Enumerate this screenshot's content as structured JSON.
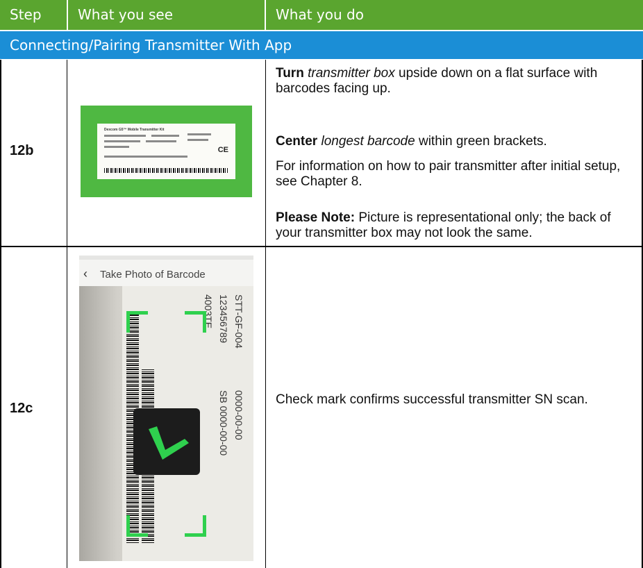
{
  "header": {
    "step_label": "Step",
    "see_label": "What you see",
    "do_label": "What you do"
  },
  "section": {
    "title": "Connecting/Pairing Transmitter With App"
  },
  "rows": [
    {
      "step": "12b",
      "image": {
        "kind": "transmitter-box-label",
        "card_title": "Dexcom G5™ Mobile Transmitter Kit",
        "mark": "CE"
      },
      "instructions": [
        {
          "bold": "Turn",
          "italic": "transmitter box",
          "rest": "upside down on a flat surface with barcodes facing up."
        },
        {
          "bold": "Center",
          "italic": "longest barcode",
          "rest": "within green brackets."
        },
        {
          "text": "For information on how to pair transmitter after initial setup, see Chapter 8."
        },
        {
          "bold": "Please Note:",
          "rest": "Picture is representational only; the back of your transmitter box may not look the same."
        }
      ]
    },
    {
      "step": "12c",
      "image": {
        "kind": "phone-screen",
        "screen_title": "Take Photo of Barcode",
        "back_icon": "chevron-left-icon",
        "check_icon": "checkmark-icon",
        "label_texts": [
          "STT-GF-004",
          "123456789",
          "4003TE",
          "0000-00-00",
          "SB 0000-00-00"
        ]
      },
      "instructions": [
        {
          "text": "Check mark confirms successful transmitter SN scan."
        }
      ]
    }
  ],
  "colors": {
    "header_green": "#5aa52f",
    "section_blue": "#1b8ed6",
    "label_green": "#4fb842",
    "bracket_green": "#2fd04e"
  }
}
